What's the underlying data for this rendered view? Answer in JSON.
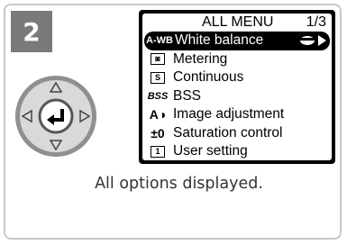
{
  "step": "2",
  "menu": {
    "title": "ALL MENU",
    "page": "1/3",
    "items": [
      {
        "icon": "A-WB",
        "icon_name": "white-balance-icon",
        "label": "White balance",
        "selected": true
      },
      {
        "icon": "◙",
        "icon_name": "metering-icon",
        "label": "Metering"
      },
      {
        "icon": "S",
        "icon_name": "continuous-icon",
        "label": "Continuous"
      },
      {
        "icon": "BSS",
        "icon_name": "bss-icon",
        "label": "BSS"
      },
      {
        "icon": "A◑",
        "icon_name": "image-adjustment-icon",
        "label": "Image adjustment"
      },
      {
        "icon": "±0",
        "icon_name": "saturation-icon",
        "label": "Saturation control"
      },
      {
        "icon": "1",
        "icon_name": "user-setting-icon",
        "label": "User setting"
      }
    ]
  },
  "caption": "All options displayed.",
  "colors": {
    "badge": "#7a7a7a",
    "dpad_outer": "#8f8f8f",
    "dpad_inner": "#d9d9d9",
    "border": "#c8c8c8"
  }
}
